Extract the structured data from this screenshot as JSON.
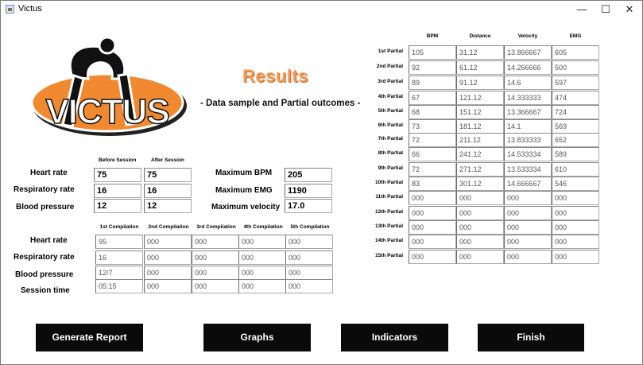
{
  "window": {
    "title": "Victus",
    "minimize": "—",
    "maximize": "☐",
    "close": "✕"
  },
  "logo": {
    "text": "VICTUS"
  },
  "header": {
    "title": "Results",
    "subtitle": "- Data sample and Partial outcomes -"
  },
  "session": {
    "col_before": "Before Session",
    "col_after": "After Session",
    "rows": [
      {
        "label": "Heart rate",
        "before": "75",
        "after": "75"
      },
      {
        "label": "Respiratory rate",
        "before": "16",
        "after": "16"
      },
      {
        "label": "Blood pressure",
        "before": "12",
        "after": "12"
      }
    ]
  },
  "maximums": [
    {
      "label": "Maximum BPM",
      "value": "205"
    },
    {
      "label": "Maximum EMG",
      "value": "1190"
    },
    {
      "label": "Maximum velocity",
      "value": "17.0"
    }
  ],
  "compilations": {
    "headers": [
      "1st Compilation",
      "2nd Compilation",
      "3rd Compilation",
      "4th Compilation",
      "5th Compilation"
    ],
    "rows": [
      {
        "label": "Heart rate",
        "values": [
          "95",
          "000",
          "000",
          "000",
          "000"
        ]
      },
      {
        "label": "Respiratory rate",
        "values": [
          "16",
          "000",
          "000",
          "000",
          "000"
        ]
      },
      {
        "label": "Blood pressure",
        "values": [
          "12/7",
          "000",
          "000",
          "000",
          "000"
        ]
      },
      {
        "label": "Session time",
        "values": [
          "05:15",
          "000",
          "000",
          "000",
          "000"
        ]
      }
    ]
  },
  "partials": {
    "headers": [
      "BPM",
      "Distance",
      "Velocity",
      "EMG"
    ],
    "rows": [
      {
        "label": "1st Partial",
        "values": [
          "105",
          "31.12",
          "13.866667",
          "605"
        ]
      },
      {
        "label": "2nd Partial",
        "values": [
          "92",
          "61.12",
          "14.266666",
          "500"
        ]
      },
      {
        "label": "3rd Partial",
        "values": [
          "89",
          "91.12",
          "14.6",
          "597"
        ]
      },
      {
        "label": "4th Partial",
        "values": [
          "67",
          "121.12",
          "14.333333",
          "474"
        ]
      },
      {
        "label": "5th Partial",
        "values": [
          "68",
          "151.12",
          "13.366667",
          "724"
        ]
      },
      {
        "label": "6th Partial",
        "values": [
          "73",
          "181.12",
          "14.1",
          "569"
        ]
      },
      {
        "label": "7th Partial",
        "values": [
          "72",
          "211.12",
          "13.833333",
          "652"
        ]
      },
      {
        "label": "8th Partial",
        "values": [
          "66",
          "241.12",
          "14.533334",
          "589"
        ]
      },
      {
        "label": "9th Partial",
        "values": [
          "72",
          "271.12",
          "13.533334",
          "610"
        ]
      },
      {
        "label": "10th Partial",
        "values": [
          "83",
          "301.12",
          "14.666667",
          "546"
        ]
      },
      {
        "label": "11th Partial",
        "values": [
          "000",
          "000",
          "000",
          "000"
        ]
      },
      {
        "label": "12th Partial",
        "values": [
          "000",
          "000",
          "000",
          "000"
        ]
      },
      {
        "label": "13th Partial",
        "values": [
          "000",
          "000",
          "000",
          "000"
        ]
      },
      {
        "label": "14th Partial",
        "values": [
          "000",
          "000",
          "000",
          "000"
        ]
      },
      {
        "label": "15th Partial",
        "values": [
          "000",
          "000",
          "000",
          "000"
        ]
      }
    ]
  },
  "buttons": {
    "generate_report": "Generate Report",
    "graphs": "Graphs",
    "indicators": "Indicators",
    "finish": "Finish"
  },
  "colors": {
    "accent_orange": "#f0892f",
    "button_bg": "#0a0a0a"
  }
}
